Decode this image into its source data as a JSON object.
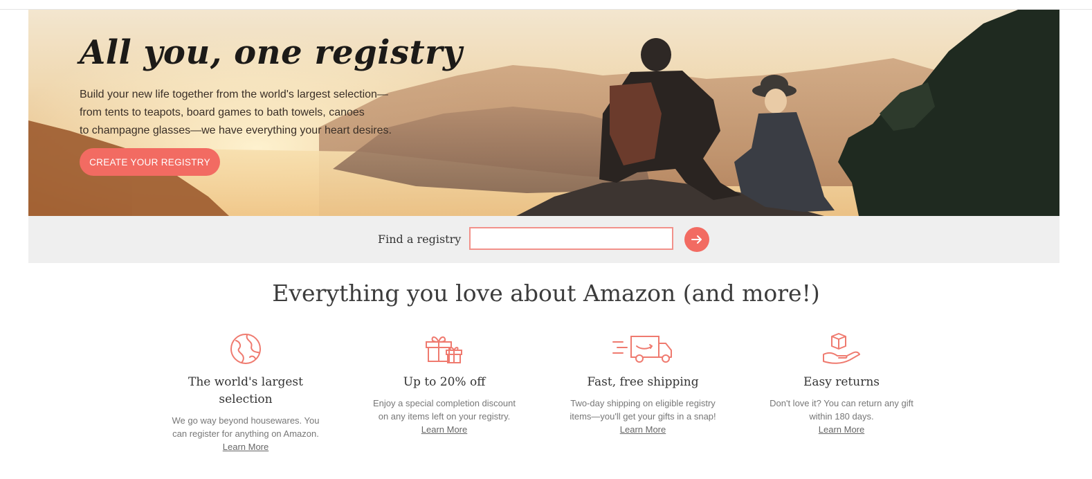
{
  "hero": {
    "title": "All you, one registry",
    "body_lines": [
      "Build your new life together from the world's largest selection—",
      "from tents to teapots, board games to bath towels, canoes",
      "to champagne glasses—we have everything your heart desires."
    ],
    "cta_label": "CREATE YOUR REGISTRY"
  },
  "find": {
    "label": "Find a registry",
    "input_value": "",
    "input_placeholder": "",
    "submit_icon": "arrow-right-icon"
  },
  "section_title": "Everything you love about Amazon (and more!)",
  "features": [
    {
      "icon": "globe-icon",
      "title_lines": [
        "The world's largest",
        "selection"
      ],
      "body_lines": [
        "We go way beyond housewares. You",
        "can register for anything on Amazon."
      ],
      "link": "Learn More"
    },
    {
      "icon": "gift-icon",
      "title_lines": [
        "Up to 20% off"
      ],
      "body_lines": [
        "Enjoy a special completion discount",
        "on any items left on your registry."
      ],
      "link": "Learn More"
    },
    {
      "icon": "delivery-truck-icon",
      "title_lines": [
        "Fast, free shipping"
      ],
      "body_lines": [
        "Two-day shipping on eligible registry",
        "items—you'll get your gifts in a snap!"
      ],
      "link": "Learn More"
    },
    {
      "icon": "box-in-hand-icon",
      "title_lines": [
        "Easy returns"
      ],
      "body_lines": [
        "Don't love it? You can return any gift",
        "within 180 days."
      ],
      "link": "Learn More"
    }
  ],
  "colors": {
    "accent": "#f26b62",
    "icon_stroke": "#ef7a6f",
    "find_bar_bg": "#efefef"
  }
}
